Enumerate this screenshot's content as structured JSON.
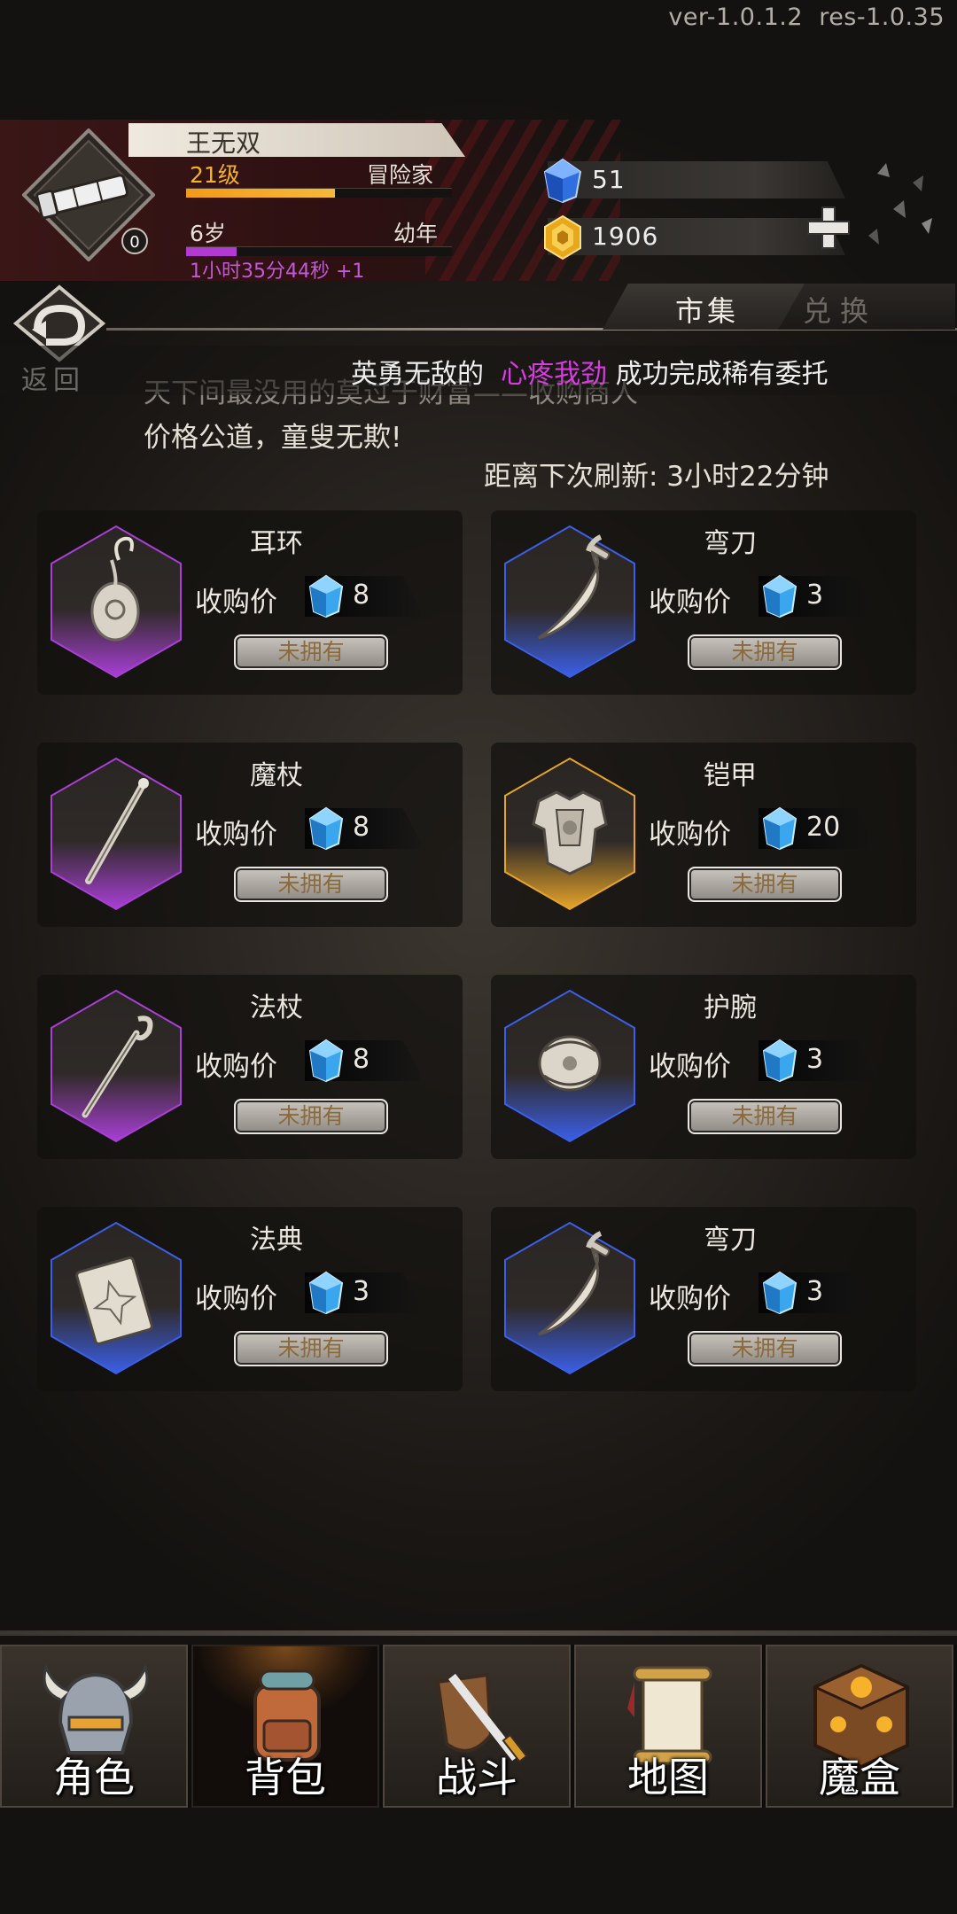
{
  "version": {
    "ver": "ver-1.0.1.2",
    "res": "res-1.0.35"
  },
  "player": {
    "name": "王无双",
    "level": "21级",
    "job": "冒险家",
    "age": "6岁",
    "stage": "幼年",
    "timer": "1小时35分44秒 +1",
    "badge": "0",
    "exp_progress": 0.56,
    "age_progress": 0.19
  },
  "resources": {
    "diamond": "51",
    "gold": "1906"
  },
  "tabs": {
    "market": "市集",
    "exchange": "兑换",
    "back": "返回"
  },
  "broadcast": {
    "prefix": "英勇无敌的",
    "player": "心疼我劲",
    "suffix": "成功完成稀有委托",
    "player_color": "#d83ce0"
  },
  "shop": {
    "flavor1": "天下间最没用的莫过于财富——收购商人",
    "flavor2": "价格公道，童叟无欺!",
    "refresh": "距离下次刷新: 3小时22分钟"
  },
  "items": [
    {
      "name": "耳环",
      "price_label": "收购价",
      "price": "8",
      "button": "未拥有",
      "rarity": "epic",
      "icon": "earring-icon"
    },
    {
      "name": "弯刀",
      "price_label": "收购价",
      "price": "3",
      "button": "未拥有",
      "rarity": "rare",
      "icon": "scimitar-icon"
    },
    {
      "name": "魔杖",
      "price_label": "收购价",
      "price": "8",
      "button": "未拥有",
      "rarity": "epic",
      "icon": "wand-icon"
    },
    {
      "name": "铠甲",
      "price_label": "收购价",
      "price": "20",
      "button": "未拥有",
      "rarity": "legendary",
      "icon": "armor-icon"
    },
    {
      "name": "法杖",
      "price_label": "收购价",
      "price": "8",
      "button": "未拥有",
      "rarity": "epic",
      "icon": "staff-icon"
    },
    {
      "name": "护腕",
      "price_label": "收购价",
      "price": "3",
      "button": "未拥有",
      "rarity": "rare",
      "icon": "bracer-icon"
    },
    {
      "name": "法典",
      "price_label": "收购价",
      "price": "3",
      "button": "未拥有",
      "rarity": "rare",
      "icon": "tome-icon"
    },
    {
      "name": "弯刀",
      "price_label": "收购价",
      "price": "3",
      "button": "未拥有",
      "rarity": "rare",
      "icon": "scimitar-icon"
    }
  ],
  "rarity_colors": {
    "epic": "#a93fd6",
    "rare": "#3b5fe8",
    "legendary": "#e7a42a"
  },
  "nav": [
    {
      "label": "角色",
      "icon": "helmet-icon"
    },
    {
      "label": "背包",
      "icon": "backpack-icon",
      "active": true
    },
    {
      "label": "战斗",
      "icon": "sword-shield-icon"
    },
    {
      "label": "地图",
      "icon": "scroll-map-icon"
    },
    {
      "label": "魔盒",
      "icon": "magic-box-icon"
    }
  ]
}
